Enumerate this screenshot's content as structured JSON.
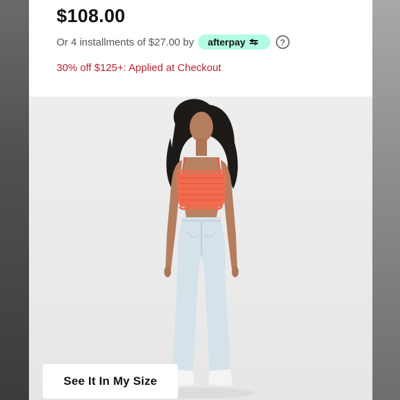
{
  "price": {
    "amount": "$108.00"
  },
  "installments": {
    "text": "Or 4 installments of $27.00 by",
    "provider": "afterpay",
    "provider_icon": "afterpay-arrows-icon",
    "help_icon": "question-circle-icon",
    "help_symbol": "?"
  },
  "promo": {
    "text": "30% off $125+: Applied at Checkout"
  },
  "product_image": {
    "size_button_label": "See It In My Size"
  },
  "colors": {
    "price_text": "#111111",
    "promo_text": "#b4232e",
    "afterpay_badge": "#b2fce4",
    "top_color": "#f26b4f",
    "jeans_color": "#d6e2ea",
    "image_background": "#ececec"
  }
}
